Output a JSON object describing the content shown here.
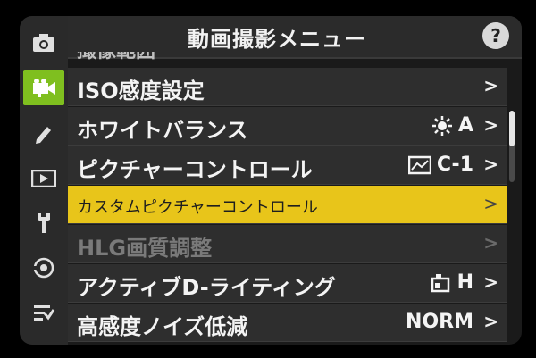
{
  "header": {
    "title": "動画撮影メニュー",
    "help_label": "?",
    "cutoff_label": "撮像範囲"
  },
  "sidebar": {
    "items": [
      {
        "icon": "camera-icon"
      },
      {
        "icon": "movie-camera-icon",
        "active": true
      },
      {
        "icon": "pencil-icon"
      },
      {
        "icon": "playback-icon"
      },
      {
        "icon": "wrench-icon"
      },
      {
        "icon": "network-icon"
      },
      {
        "icon": "my-menu-icon"
      }
    ]
  },
  "menu": {
    "items": [
      {
        "label": "ISO感度設定",
        "value": ""
      },
      {
        "label": "ホワイトバランス",
        "value": "A"
      },
      {
        "label": "ピクチャーコントロール",
        "value": "C-1"
      },
      {
        "label": "カスタムピクチャーコントロール",
        "value": "",
        "selected": true
      },
      {
        "label": "HLG画質調整",
        "value": "",
        "disabled": true
      },
      {
        "label": "アクティブD-ライティング",
        "value": "H"
      },
      {
        "label": "高感度ノイズ低減",
        "value": "NORM"
      }
    ],
    "chevron": ">"
  },
  "scroll": {
    "position": 0.0
  }
}
